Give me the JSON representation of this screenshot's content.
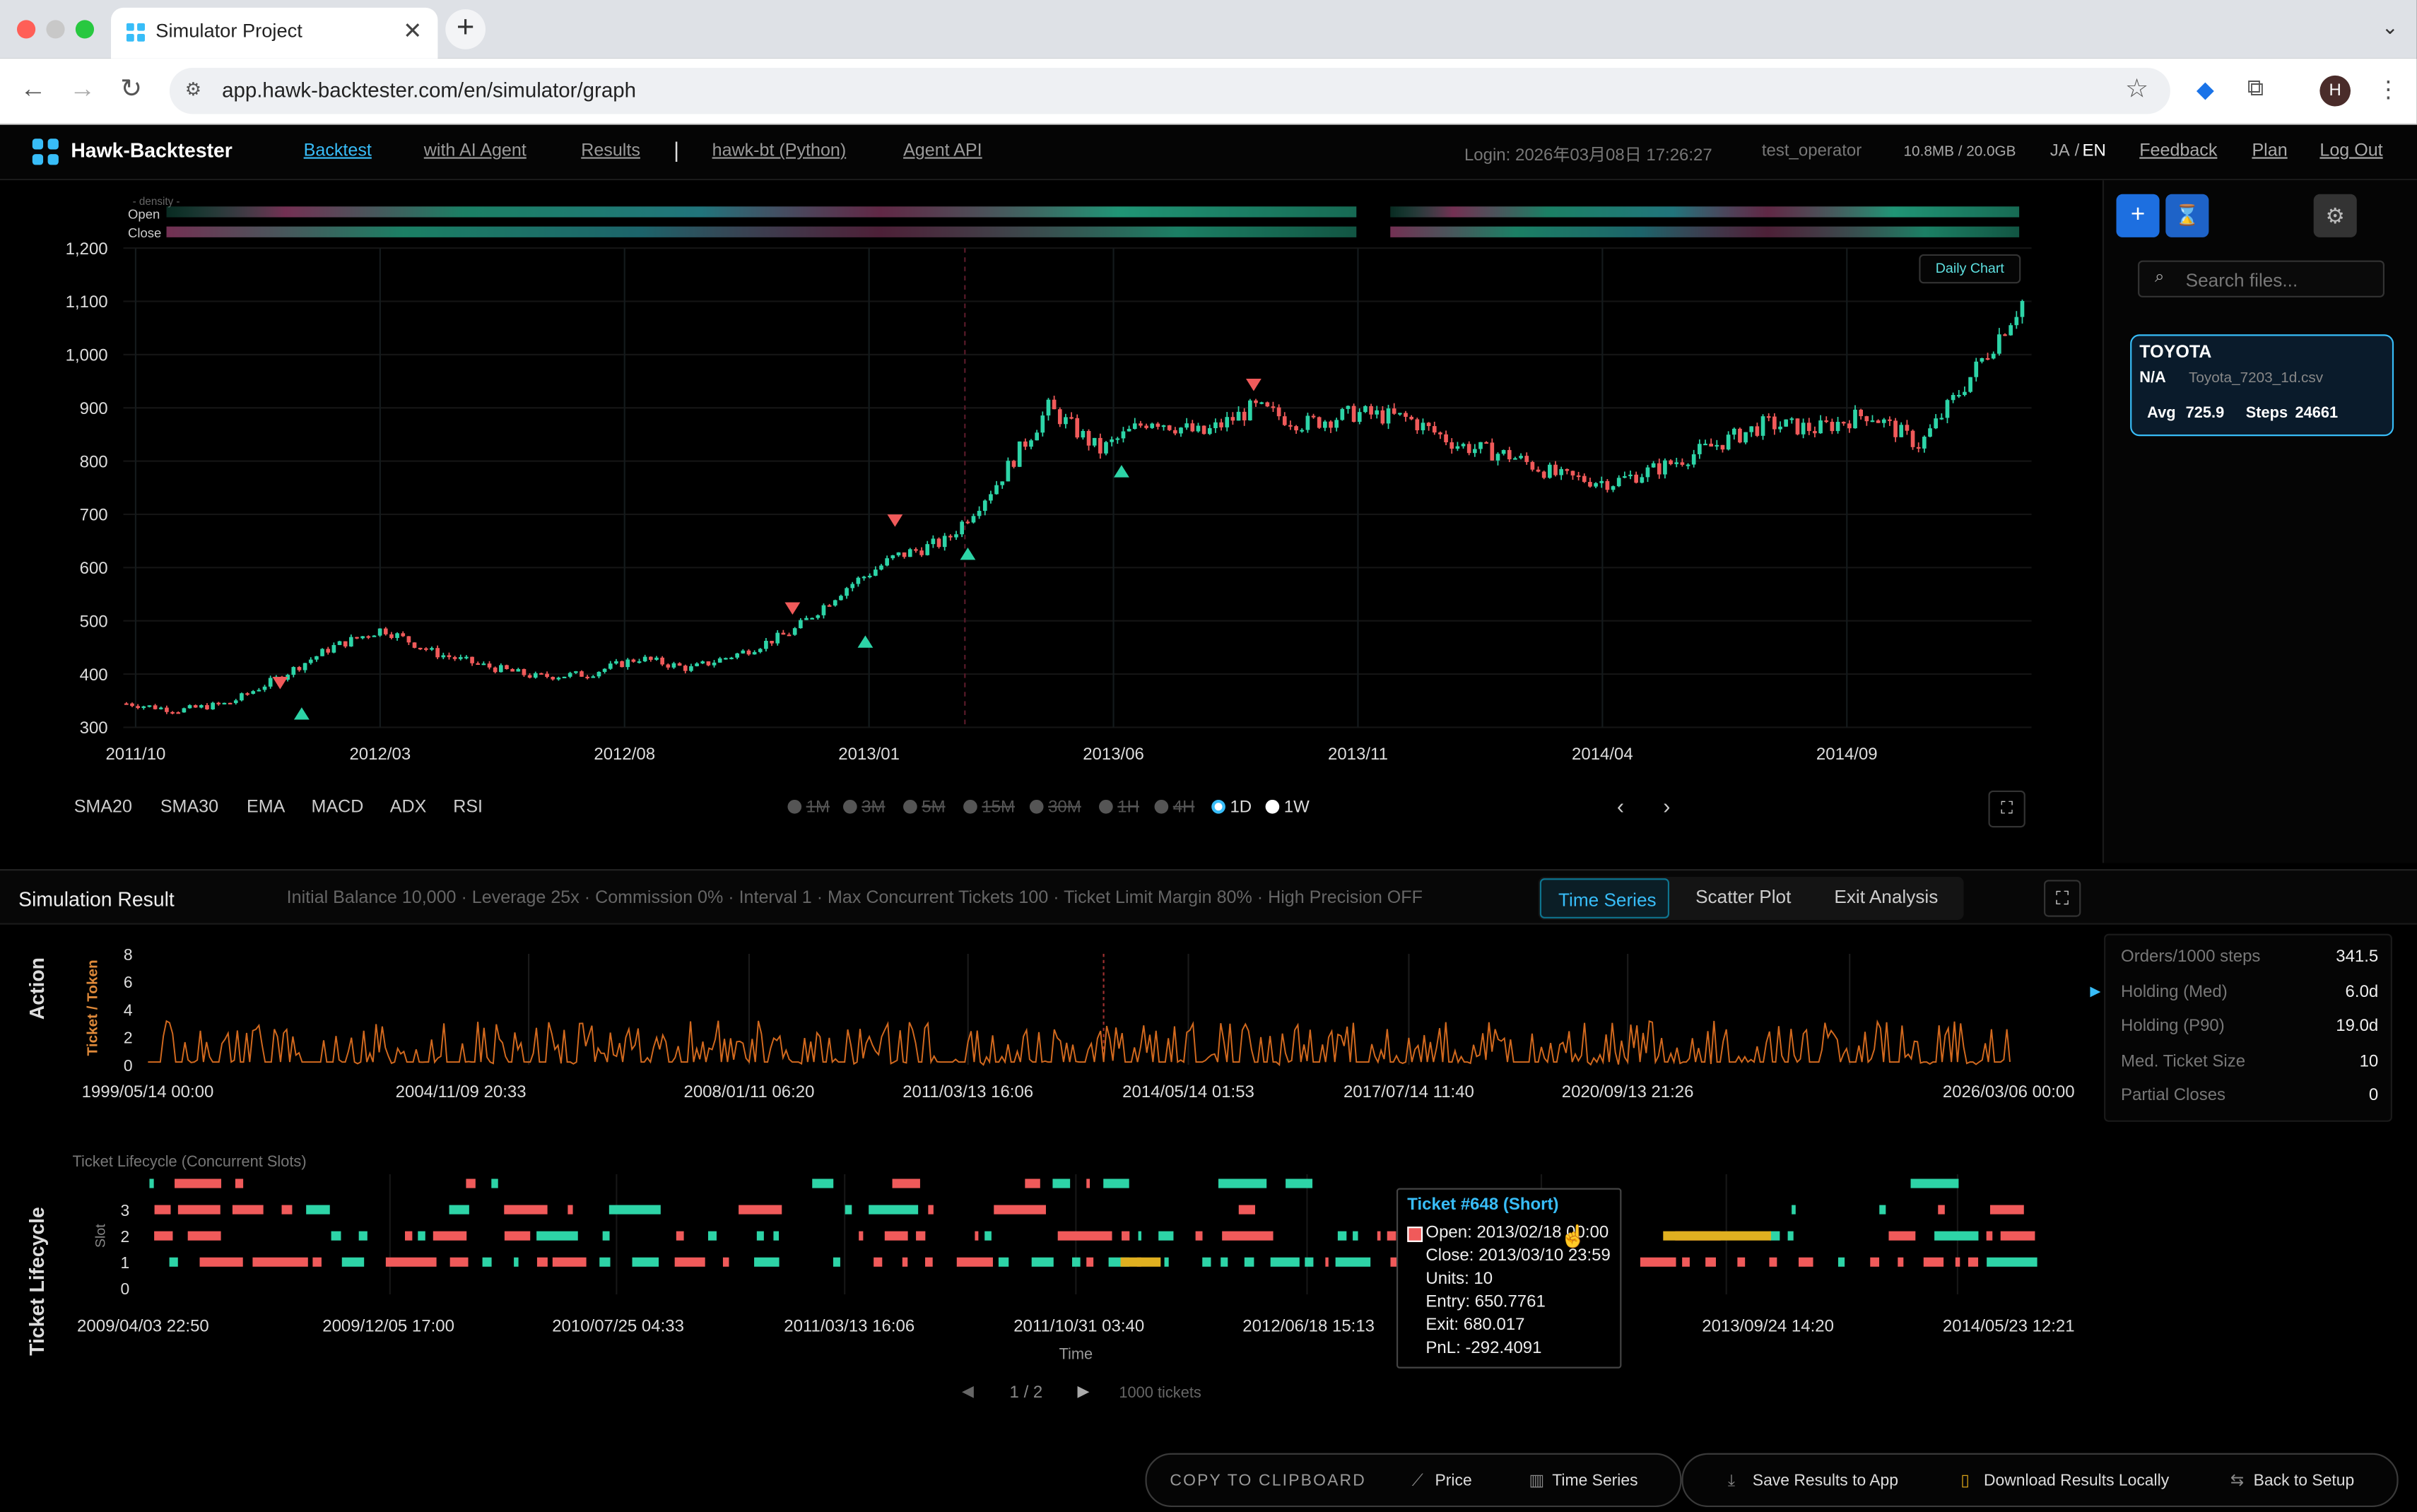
{
  "browser": {
    "tab_title": "Simulator Project",
    "url": "app.hawk-backtester.com/en/simulator/graph",
    "avatar_letter": "H"
  },
  "header": {
    "brand": "Hawk-Backtester",
    "nav": [
      "Backtest",
      "with AI Agent",
      "Results",
      "hawk-bt (Python)",
      "Agent API"
    ],
    "separator": "|",
    "login": "Login: 2026年03月08日 17:26:27",
    "user": "test_operator",
    "storage": "10.8MB / 20.0GB",
    "lang_ja": "JA",
    "lang_sep": "/",
    "lang_en": "EN",
    "links": [
      "Feedback",
      "Plan",
      "Log Out"
    ]
  },
  "chart": {
    "density_label": "- density -",
    "open_label": "Open",
    "close_label": "Close",
    "daily_badge": "Daily Chart",
    "indicators": [
      "SMA20",
      "SMA30",
      "EMA",
      "MACD",
      "ADX",
      "RSI"
    ],
    "timeframes": [
      "1M",
      "3M",
      "5M",
      "15M",
      "30M",
      "1H",
      "4H",
      "1D",
      "1W"
    ],
    "active_timeframe": "1D"
  },
  "chart_data": {
    "type": "line",
    "title": "",
    "series_kind": "candlestick",
    "x_ticks": [
      "2011/10",
      "2012/03",
      "2012/08",
      "2013/01",
      "2013/06",
      "2013/11",
      "2014/04",
      "2014/09"
    ],
    "y_ticks": [
      "300",
      "400",
      "500",
      "600",
      "700",
      "800",
      "900",
      "1,000",
      "1,100",
      "1,200"
    ],
    "ylim": [
      300,
      1200
    ],
    "x": [
      "2011/10",
      "2011/12",
      "2012/01",
      "2012/02",
      "2012/03",
      "2012/04",
      "2012/05",
      "2012/06",
      "2012/07",
      "2012/08",
      "2012/09",
      "2012/10",
      "2012/11",
      "2012/12",
      "2013/01",
      "2013/02",
      "2013/03",
      "2013/04",
      "2013/05",
      "2013/06",
      "2013/07",
      "2013/08",
      "2013/09",
      "2013/10",
      "2013/11",
      "2013/12",
      "2014/01",
      "2014/02",
      "2014/03",
      "2014/04",
      "2014/05",
      "2014/06",
      "2014/07",
      "2014/08",
      "2014/09",
      "2014/10",
      "2014/11",
      "2014/12"
    ],
    "y": [
      345,
      332,
      345,
      395,
      450,
      485,
      440,
      415,
      395,
      400,
      430,
      410,
      440,
      480,
      560,
      620,
      650,
      760,
      900,
      820,
      880,
      850,
      900,
      870,
      890,
      880,
      830,
      810,
      770,
      760,
      790,
      830,
      870,
      860,
      890,
      830,
      960,
      1100
    ],
    "sell_markers": [
      {
        "x": "2012/02",
        "y": 360
      },
      {
        "x": "2012/12",
        "y": 500
      },
      {
        "x": "2013/02",
        "y": 665
      },
      {
        "x": "2013/09",
        "y": 920
      }
    ],
    "buy_markers": [
      {
        "x": "2012/02",
        "y": 355
      },
      {
        "x": "2013/01",
        "y": 490
      },
      {
        "x": "2013/03",
        "y": 655
      },
      {
        "x": "2013/06",
        "y": 810
      }
    ]
  },
  "sidebar": {
    "search_placeholder": "Search files...",
    "file": {
      "name": "TOYOTA",
      "na": "N/A",
      "filename": "Toyota_7203_1d.csv",
      "avg_label": "Avg",
      "avg": "725.9",
      "steps_label": "Steps",
      "steps": "24661"
    }
  },
  "results": {
    "title": "Simulation Result",
    "params": "Initial Balance 10,000 · Leverage 25x · Commission 0% · Interval 1 · Max Concurrent Tickets 100 · Ticket Limit Margin 80% · High Precision OFF",
    "tabs": [
      "Time Series",
      "Scatter Plot",
      "Exit Analysis"
    ],
    "action_title": "Action",
    "action_axis": "Ticket / Token",
    "action_y": [
      "8",
      "6",
      "4",
      "2",
      "0"
    ],
    "action_x": [
      "1999/05/14 00:00",
      "2004/11/09 20:33",
      "2008/01/11 06:20",
      "2011/03/13 16:06",
      "2014/05/14 01:53",
      "2017/07/14 11:40",
      "2020/09/13 21:26",
      "2026/03/06 00:00"
    ],
    "lifecycle_title": "Ticket Lifecycle",
    "lifecycle_subtitle": "Ticket Lifecycle (Concurrent Slots)",
    "slot_axis": "Slot",
    "slot_y": [
      "3",
      "2",
      "1",
      "0"
    ],
    "lifecycle_x": [
      "2009/04/03 22:50",
      "2009/12/05 17:00",
      "2010/07/25 04:33",
      "2011/03/13 16:06",
      "2011/10/31 03:40",
      "2012/06/18 15:13",
      "2013/09/24 14:20",
      "2014/05/23 12:21"
    ],
    "time_label": "Time",
    "page": "1 / 2",
    "tickets": "1000 tickets"
  },
  "stats": [
    {
      "k": "Orders/1000 steps",
      "v": "341.5"
    },
    {
      "k": "Holding (Med)",
      "v": "6.0d"
    },
    {
      "k": "Holding (P90)",
      "v": "19.0d"
    },
    {
      "k": "Med. Ticket Size",
      "v": "10"
    },
    {
      "k": "Partial Closes",
      "v": "0"
    }
  ],
  "tooltip": {
    "title": "Ticket #648 (Short)",
    "lines": [
      "Open: 2013/02/18 00:00",
      "Close: 2013/03/10 23:59",
      "Units: 10",
      "Entry: 650.7761",
      "Exit: 680.017",
      "PnL: -292.4091"
    ]
  },
  "toolbar": {
    "copy": "COPY TO CLIPBOARD",
    "price": "Price",
    "time_series": "Time Series",
    "save": "Save Results to App",
    "download": "Download Results Locally",
    "back": "Back to Setup"
  },
  "colors": {
    "accent": "#38bdf8",
    "up": "#2dd4a7",
    "down": "#f05a5a",
    "action": "#d2691e",
    "open_slot": "#e0b020"
  }
}
